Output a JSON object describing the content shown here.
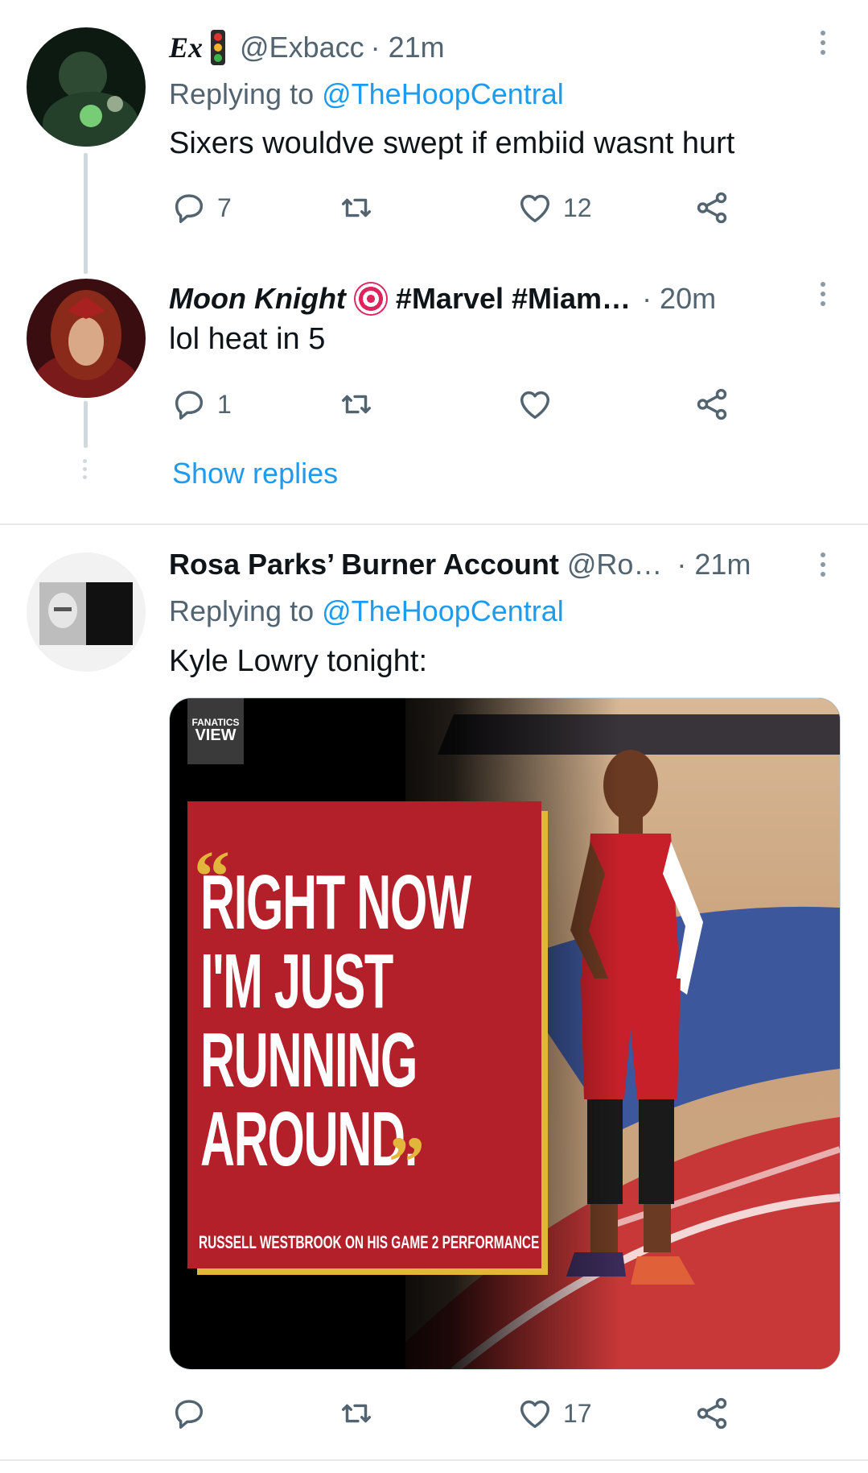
{
  "tweets": [
    {
      "display_name": "Ex",
      "handle": "@Exbacc",
      "time": "· 21m",
      "replying_prefix": "Replying to ",
      "replying_to": "@TheHoopCentral",
      "text": "Sixers wouldve swept if embiid wasnt hurt",
      "reply_count": "7",
      "retweet_count": "",
      "like_count": "12"
    },
    {
      "display_name": "Moon Knight",
      "name_suffix": "#Marvel #Miam…",
      "time": "· 20m",
      "text": "lol heat in 5",
      "reply_count": "1",
      "retweet_count": "",
      "like_count": ""
    },
    {
      "display_name": "Rosa Parks’ Burner Account",
      "handle": "@Ro…",
      "time": "· 21m",
      "replying_prefix": "Replying to ",
      "replying_to": "@TheHoopCentral",
      "text": "Kyle Lowry tonight:",
      "reply_count": "",
      "retweet_count": "",
      "like_count": "17",
      "media": {
        "logo_line1": "FANATICS",
        "logo_line2": "VIEW",
        "quote_line1": "RIGHT NOW",
        "quote_line2": "I'M JUST",
        "quote_line3": "RUNNING",
        "quote_line4": "AROUND.",
        "caption": "RUSSELL WESTBROOK ON HIS GAME 2 PERFORMANCE"
      }
    }
  ],
  "show_replies": "Show replies",
  "colors": {
    "link": "#1d9bf0",
    "secondary": "#536471",
    "divider": "#e7e9ea",
    "quote_red": "#b3202a",
    "quote_gold": "#e2b63b"
  },
  "icons": [
    "more-icon",
    "reply-icon",
    "retweet-icon",
    "like-icon",
    "share-icon",
    "traffic-light-emoji",
    "target-emoji"
  ]
}
